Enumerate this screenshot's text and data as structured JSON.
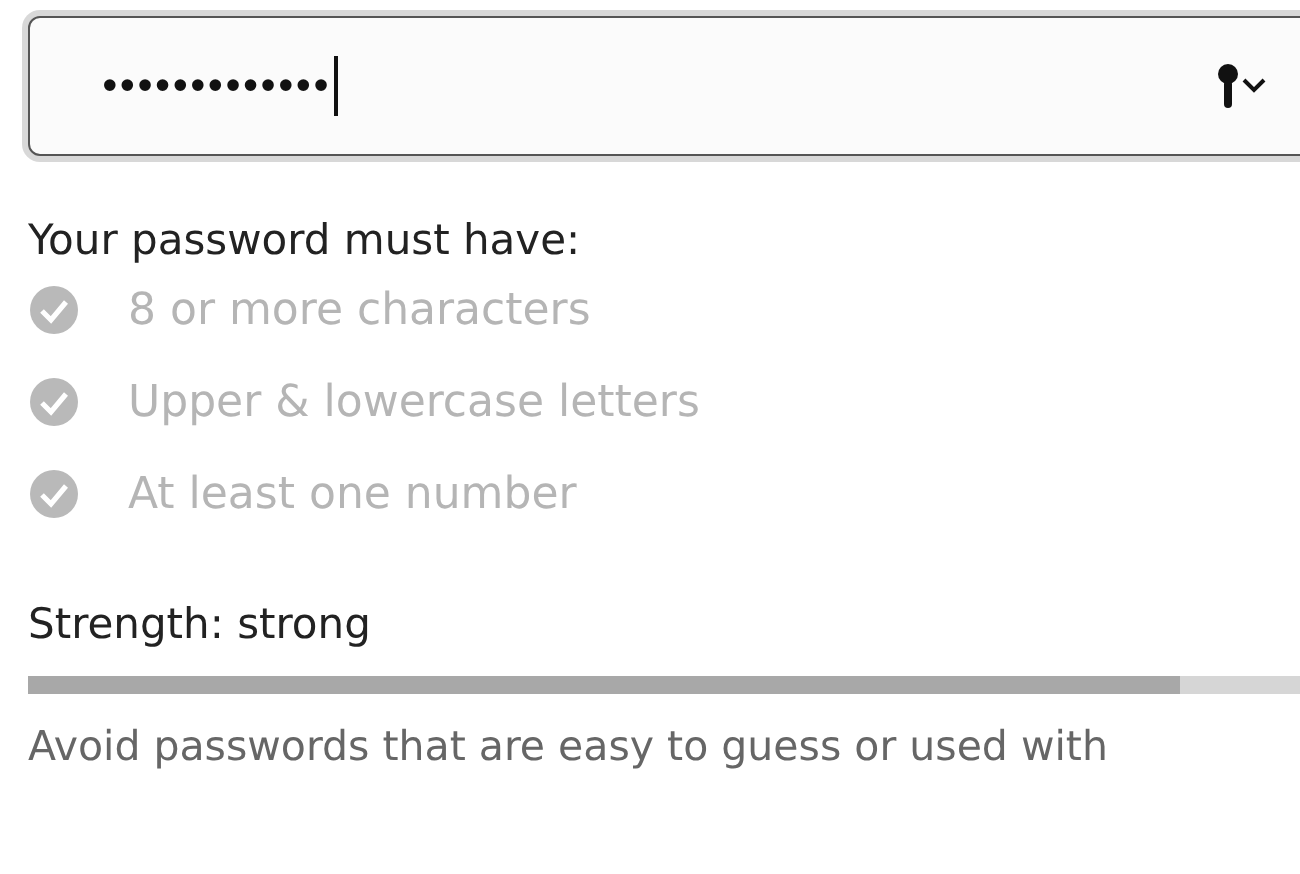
{
  "password_field": {
    "value": "•••••••••••••",
    "focused": true
  },
  "requirements": {
    "heading": "Your password must have:",
    "items": [
      {
        "label": "8 or more characters",
        "met": true
      },
      {
        "label": "Upper & lowercase letters",
        "met": true
      },
      {
        "label": "At least one number",
        "met": true
      }
    ]
  },
  "strength": {
    "label": "Strength: strong",
    "level": 0.9
  },
  "hint": "Avoid passwords that are easy to guess or used with"
}
